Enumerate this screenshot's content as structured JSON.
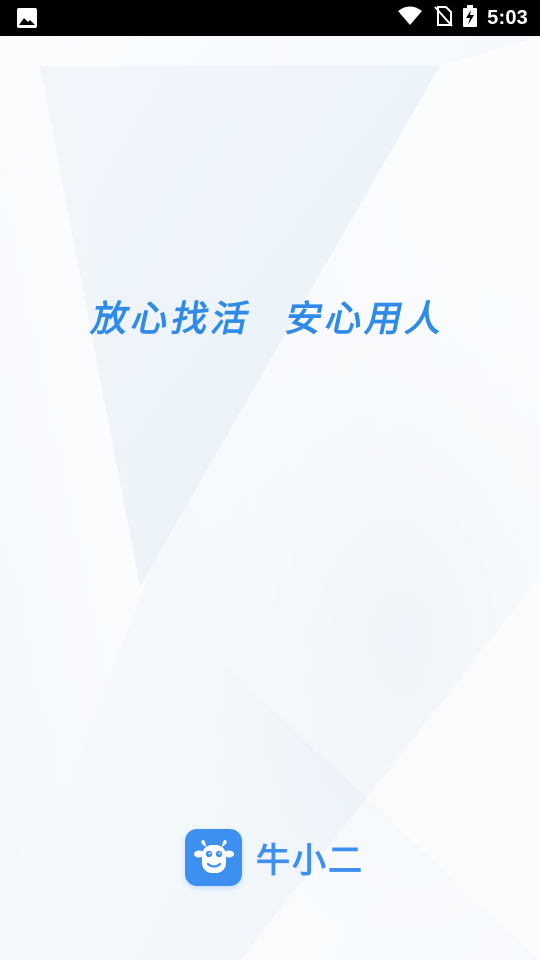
{
  "status_bar": {
    "time": "5:03",
    "icons": [
      "image-icon",
      "wifi-icon",
      "no-sim-icon",
      "battery-charging-icon"
    ]
  },
  "splash": {
    "slogan_left": "放心找活",
    "slogan_right": "安心用人",
    "app_name": "牛小二",
    "logo_icon": "cow-face-icon"
  },
  "colors": {
    "accent": "#2f8ae8",
    "logo_bg": "#3d8ff0",
    "status_bar_bg": "#000000"
  }
}
